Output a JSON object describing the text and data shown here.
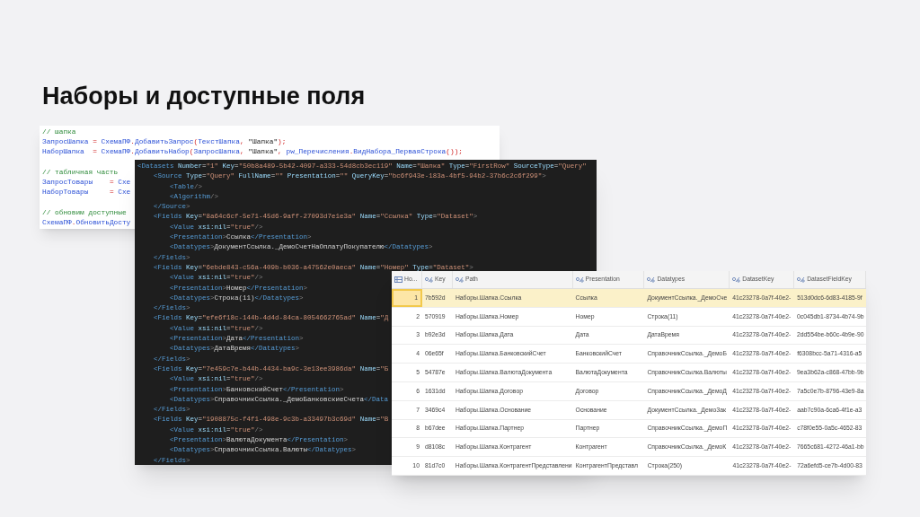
{
  "slide": {
    "title": "Наборы и доступные поля"
  },
  "code_snippet": {
    "blocks": [
      [
        "// шапка",
        "ЗапросШапка = СхемаПФ.ДобавитьЗапрос(ТекстШапка, \"Шапка\");",
        "НаборШапка  = СхемаПФ.ДобавитьНабор(ЗапросШапка, \"Шапка\", pw_Перечисления.ВидНабора_ПерваяСтрока());"
      ],
      [
        "// табличная часть",
        "ЗапросТовары    = Схе",
        "НаборТовары     = Схе"
      ],
      [
        "// обновим доступные",
        "СхемаПФ.ОбновитьДосту"
      ]
    ]
  },
  "xml_listing": {
    "lines": [
      "<Datasets Number=\"1\" Key=\"50b8a489-5b42-4097-a333-54d8cb3ec119\" Name=\"Шапка\" Type=\"FirstRow\" SourceType=\"Query\"",
      "    <Source Type=\"Query\" FullName=\"\" Presentation=\"\" QueryKey=\"bc6f943e-183a-4bf5-94b2-37b6c2c6f299\">",
      "        <Table/>",
      "        <Algorithm/>",
      "    </Source>",
      "    <Fields Key=\"8a64c6cf-5e71-45d6-9aff-27093d7e1e3a\" Name=\"Ссылка\" Type=\"Dataset\">",
      "        <Value xsi:nil=\"true\"/>",
      "        <Presentation>Ссылка</Presentation>",
      "        <Datatypes>ДокументСсылка._ДемоСчетНаОплатуПокупателю</Datatypes>",
      "    </Fields>",
      "    <Fields Key=\"6ebde843-c56a-409b-b036-a47562e0aeca\" Name=\"Номер\" Type=\"Dataset\">",
      "        <Value xsi:nil=\"true\"/>",
      "        <Presentation>Номер</Presentation>",
      "        <Datatypes>Строка(11)</Datatypes>",
      "    </Fields>",
      "    <Fields Key=\"efe6f18c-144b-4d4d-84ca-8054662765ad\" Name=\"Д",
      "        <Value xsi:nil=\"true\"/>",
      "        <Presentation>Дата</Presentation>",
      "        <Datatypes>ДатаВремя</Datatypes>",
      "    </Fields>",
      "    <Fields Key=\"7e459c7e-b44b-4434-ba9c-3e13ee3986da\" Name=\"Б",
      "        <Value xsi:nil=\"true\"/>",
      "        <Presentation>БанковскийСчет</Presentation>",
      "        <Datatypes>СправочникСсылка._ДемоБанковскиеСчета</Data",
      "    </Fields>",
      "    <Fields Key=\"1908875c-f4f1-498e-9c3b-a33497b3c69d\" Name=\"В",
      "        <Value xsi:nil=\"true\"/>",
      "        <Presentation>ВалютаДокумента</Presentation>",
      "        <Datatypes>СправочникСсылка.Валюты</Datatypes>",
      "    </Fields>"
    ]
  },
  "table": {
    "columns": [
      {
        "label": "Но...",
        "kind": "number"
      },
      {
        "label": "Key",
        "kind": "string"
      },
      {
        "label": "Path",
        "kind": "string"
      },
      {
        "label": "Presentation",
        "kind": "string"
      },
      {
        "label": "Datatypes",
        "kind": "string"
      },
      {
        "label": "DatasetKey",
        "kind": "string"
      },
      {
        "label": "DatasetFieldKey",
        "kind": "string"
      }
    ],
    "rows": [
      {
        "selected": true,
        "cells": [
          "1",
          "7b592d",
          "Наборы.Шапка.Ссылка",
          "Ссылка",
          "ДокументСсылка._ДемоСче",
          "41c23278-0a7f-40e2-",
          "513d0dc6-6d83-4185-9f"
        ]
      },
      {
        "selected": false,
        "cells": [
          "2",
          "570919",
          "Наборы.Шапка.Номер",
          "Номер",
          "Строка(11)",
          "41c23278-0a7f-40e2-",
          "0c045db1-8734-4b74-9b"
        ]
      },
      {
        "selected": false,
        "cells": [
          "3",
          "b92e3d",
          "Наборы.Шапка.Дата",
          "Дата",
          "ДатаВремя",
          "41c23278-0a7f-40e2-",
          "2dd554be-b60c-4b9e-90"
        ]
      },
      {
        "selected": false,
        "cells": [
          "4",
          "06e65f",
          "Наборы.Шапка.БанковскийСчет",
          "БанковскийСчет",
          "СправочникСсылка._ДемоБ",
          "41c23278-0a7f-40e2-",
          "f6308bcc-5a71-4316-a5"
        ]
      },
      {
        "selected": false,
        "cells": [
          "5",
          "54787e",
          "Наборы.Шапка.ВалютаДокумента",
          "ВалютаДокумента",
          "СправочникСсылка.Валюты",
          "41c23278-0a7f-40e2-",
          "9ea3b62a-c868-47bb-9b"
        ]
      },
      {
        "selected": false,
        "cells": [
          "6",
          "1631dd",
          "Наборы.Шапка.Договор",
          "Договор",
          "СправочникСсылка._ДемоД",
          "41c23278-0a7f-40e2-",
          "7a5c0e7b-8796-43e9-8a"
        ]
      },
      {
        "selected": false,
        "cells": [
          "7",
          "3469c4",
          "Наборы.Шапка.Основание",
          "Основание",
          "ДокументСсылка._ДемоЗак",
          "41c23278-0a7f-40e2-",
          "aab7c90a-6ca6-4f1e-a3"
        ]
      },
      {
        "selected": false,
        "cells": [
          "8",
          "b67dee",
          "Наборы.Шапка.Партнер",
          "Партнер",
          "СправочникСсылка._ДемоП",
          "41c23278-0a7f-40e2-",
          "c78f0e55-0a5c-4652-83"
        ]
      },
      {
        "selected": false,
        "cells": [
          "9",
          "d8108c",
          "Наборы.Шапка.Контрагент",
          "Контрагент",
          "СправочникСсылка._ДемоК",
          "41c23278-0a7f-40e2-",
          "7665c681-4272-46a1-bb"
        ]
      },
      {
        "selected": false,
        "cells": [
          "10",
          "81d7c0",
          "Наборы.Шапка.КонтрагентПредставлени",
          "КонтрагентПредставл",
          "Строка(250)",
          "41c23278-0a7f-40e2-",
          "72a6efd5-ce7b-4d00-83"
        ]
      }
    ]
  }
}
